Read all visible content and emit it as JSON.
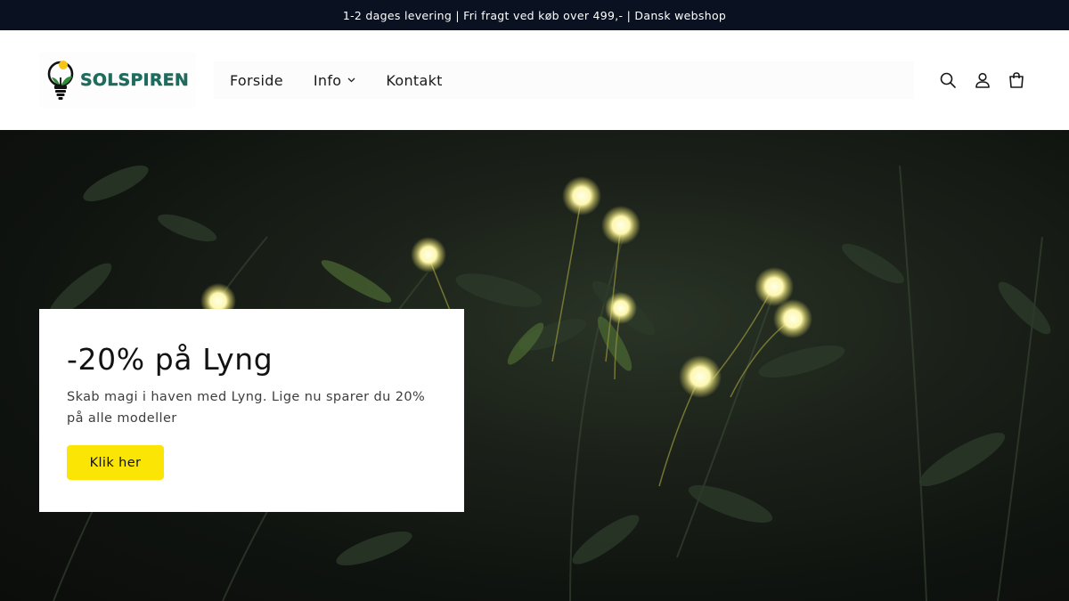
{
  "announcement": {
    "text": "1-2 dages levering | Fri fragt ved køb over 499,- | Dansk webshop"
  },
  "header": {
    "logo_text": "SOLSPIREN",
    "nav": [
      {
        "label": "Forside"
      },
      {
        "label": "Info",
        "has_dropdown": true
      },
      {
        "label": "Kontakt"
      }
    ],
    "icons": [
      "search-icon",
      "account-icon",
      "cart-icon"
    ]
  },
  "hero": {
    "title": "-20% på Lyng",
    "description": "Skab magi i haven med Lyng. Lige nu sparer du 20% på alle modeller",
    "cta_label": "Klik her",
    "cta_color": "#fbe505"
  },
  "colors": {
    "announcement_bg": "#0a1120",
    "logo_text": "#1f6b5e",
    "hero_bg": "#1b2119"
  }
}
